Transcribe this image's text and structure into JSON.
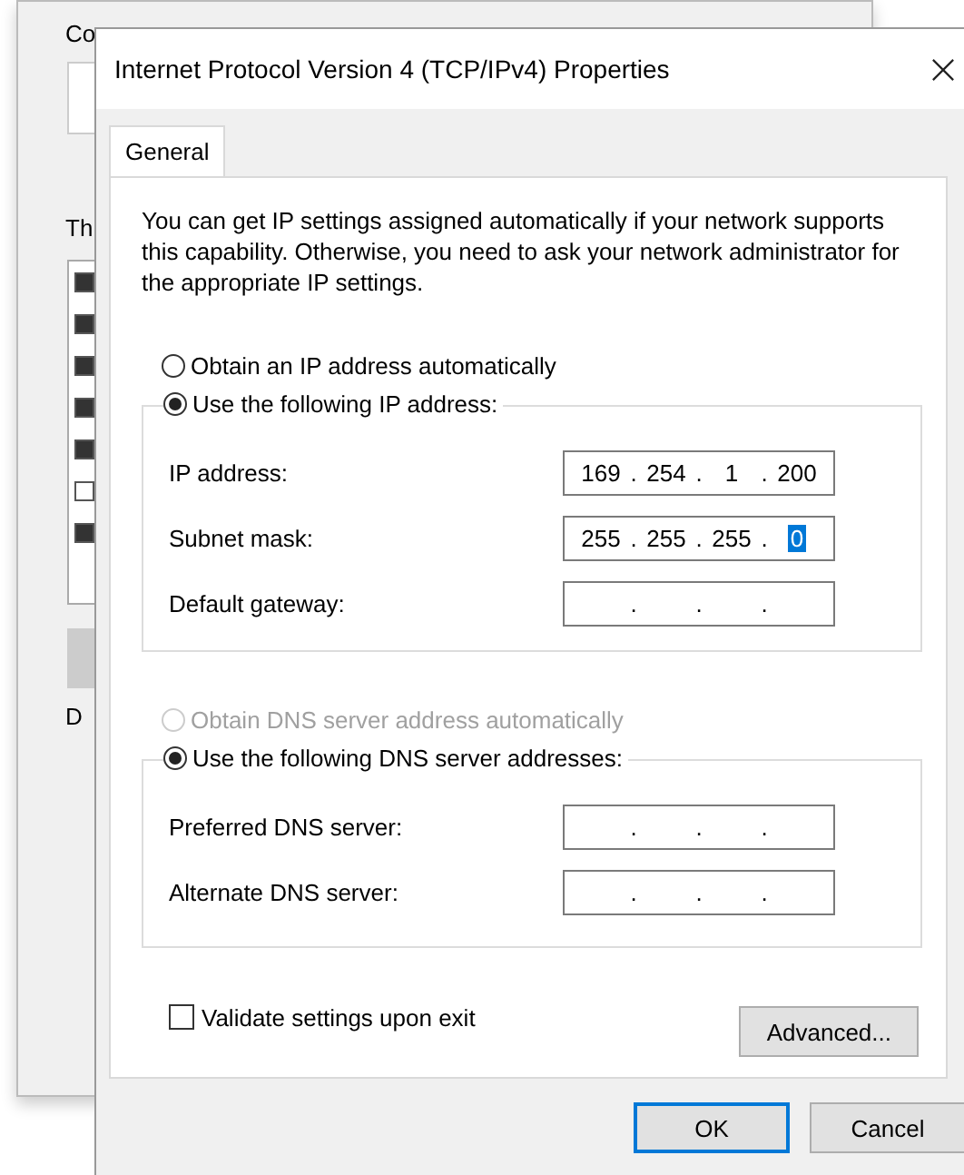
{
  "background_window": {
    "label_1": "Co",
    "label_2": "Th",
    "label_3": "D",
    "items": [
      {
        "checked": true
      },
      {
        "checked": true
      },
      {
        "checked": true
      },
      {
        "checked": true
      },
      {
        "checked": true
      },
      {
        "checked": false
      },
      {
        "checked": true
      }
    ]
  },
  "dialog": {
    "title": "Internet Protocol Version 4 (TCP/IPv4) Properties"
  },
  "tabs": [
    {
      "label": "General",
      "selected": true
    }
  ],
  "description": "You can get IP settings assigned automatically if your network supports this capability. Otherwise, you need to ask your network administrator for the appropriate IP settings.",
  "separator": ".",
  "ip_mode": [
    {
      "label": "Obtain an IP address automatically",
      "selected": false,
      "disabled": false
    },
    {
      "label": "Use the following IP address:",
      "selected": true,
      "disabled": false
    }
  ],
  "ip_fields": [
    {
      "label": "IP address:",
      "octets": [
        {
          "text": "169",
          "selected": false
        },
        {
          "text": "254",
          "selected": false
        },
        {
          "text": "1",
          "selected": false
        },
        {
          "text": "200",
          "selected": false
        }
      ]
    },
    {
      "label": "Subnet mask:",
      "octets": [
        {
          "text": "255",
          "selected": false
        },
        {
          "text": "255",
          "selected": false
        },
        {
          "text": "255",
          "selected": false
        },
        {
          "text": "0",
          "selected": true
        }
      ]
    },
    {
      "label": "Default gateway:"
    }
  ],
  "dns_mode": [
    {
      "label": "Obtain DNS server address automatically",
      "selected": false,
      "disabled": true
    },
    {
      "label": "Use the following DNS server addresses:",
      "selected": true,
      "disabled": false
    }
  ],
  "dns_fields": [
    {
      "label": "Preferred DNS server:"
    },
    {
      "label": "Alternate DNS server:"
    }
  ],
  "validate": {
    "label": "Validate settings upon exit",
    "checked": false
  },
  "advanced_button": "Advanced...",
  "buttons": [
    {
      "label": "OK",
      "focused": true
    },
    {
      "label": "Cancel",
      "focused": false
    }
  ]
}
